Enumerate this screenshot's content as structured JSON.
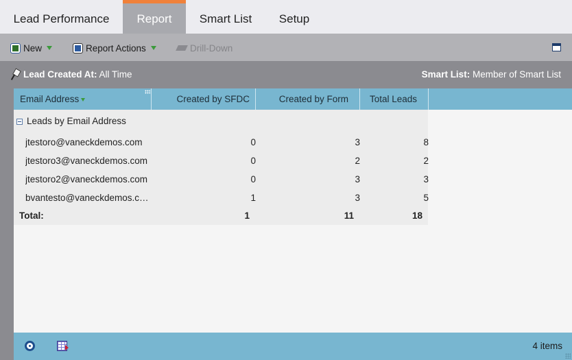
{
  "tabs": [
    {
      "label": "Lead Performance"
    },
    {
      "label": "Report"
    },
    {
      "label": "Smart List"
    },
    {
      "label": "Setup"
    }
  ],
  "active_tab": "Report",
  "toolbar": {
    "new_label": "New",
    "report_actions_label": "Report Actions",
    "drill_down_label": "Drill-Down"
  },
  "filter": {
    "left_key": "Lead Created At:",
    "left_value": "All Time",
    "right_key": "Smart List:",
    "right_value": "Member of Smart List"
  },
  "grid": {
    "columns": [
      "Email Address",
      "Created by SFDC",
      "Created by Form",
      "Total Leads"
    ],
    "group_label": "Leads by Email Address",
    "rows": [
      {
        "email": "jtestoro@vaneckdemos.com",
        "sfdc": "0",
        "form": "3",
        "total": "8"
      },
      {
        "email": "jtestoro3@vaneckdemos.com",
        "sfdc": "0",
        "form": "2",
        "total": "2"
      },
      {
        "email": "jtestoro2@vaneckdemos.com",
        "sfdc": "0",
        "form": "3",
        "total": "3"
      },
      {
        "email": "bvantesto@vaneckdemos.co...",
        "sfdc": "1",
        "form": "3",
        "total": "5"
      }
    ],
    "total": {
      "label": "Total:",
      "sfdc": "1",
      "form": "11",
      "total": "18"
    }
  },
  "footer": {
    "items_count": "4 items"
  },
  "colors": {
    "accent_tab": "#f0813a",
    "header_blue": "#78b6d0",
    "toolbar_gray": "#b2b2b6",
    "filter_gray": "#8b8b90"
  }
}
